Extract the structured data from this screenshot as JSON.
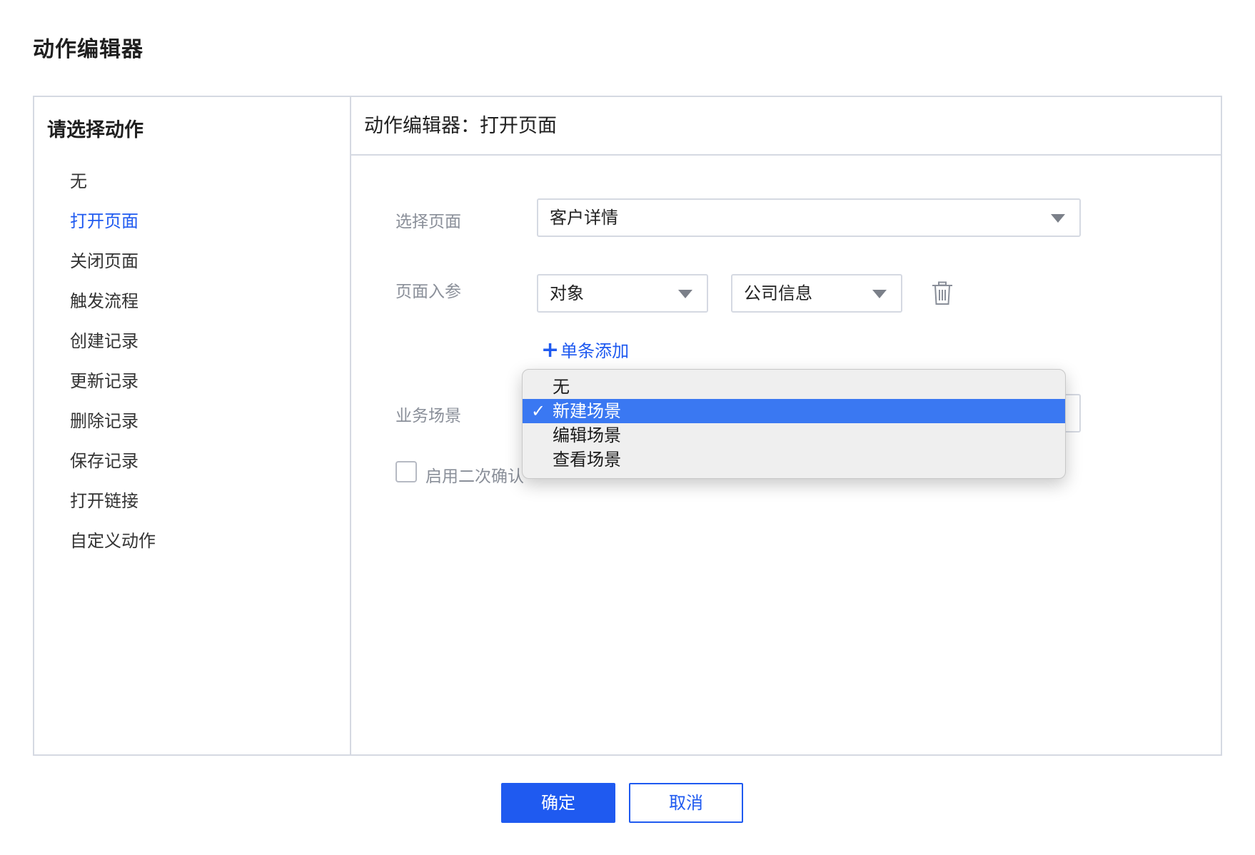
{
  "dialog": {
    "title": "动作编辑器"
  },
  "left_panel": {
    "heading": "请选择动作",
    "items": [
      {
        "label": "无"
      },
      {
        "label": "打开页面"
      },
      {
        "label": "关闭页面"
      },
      {
        "label": "触发流程"
      },
      {
        "label": "创建记录"
      },
      {
        "label": "更新记录"
      },
      {
        "label": "删除记录"
      },
      {
        "label": "保存记录"
      },
      {
        "label": "打开链接"
      },
      {
        "label": "自定义动作"
      }
    ],
    "active_item": "打开页面"
  },
  "editor": {
    "heading": "动作编辑器：打开页面",
    "select_page": {
      "label": "选择页面",
      "value": "客户详情"
    },
    "page_params": {
      "label": "页面入参",
      "type_value": "对象",
      "object_value": "公司信息"
    },
    "add_single_label": "单条添加",
    "business_scene": {
      "label": "业务场景",
      "options": [
        {
          "label": "无"
        },
        {
          "label": "新建场景"
        },
        {
          "label": "编辑场景"
        },
        {
          "label": "查看场景"
        }
      ],
      "selected": "新建场景"
    },
    "second_confirm": {
      "label": "启用二次确认",
      "checked": false
    }
  },
  "footer": {
    "confirm_label": "确定",
    "cancel_label": "取消"
  },
  "colors": {
    "accent": "#1f5af0",
    "border": "#d5d9e2",
    "highlight": "#3a78f2"
  },
  "icons": {
    "delete": "trash-icon",
    "add": "plus-icon",
    "dropdown": "caret-down-icon",
    "selected": "checkmark-icon"
  }
}
